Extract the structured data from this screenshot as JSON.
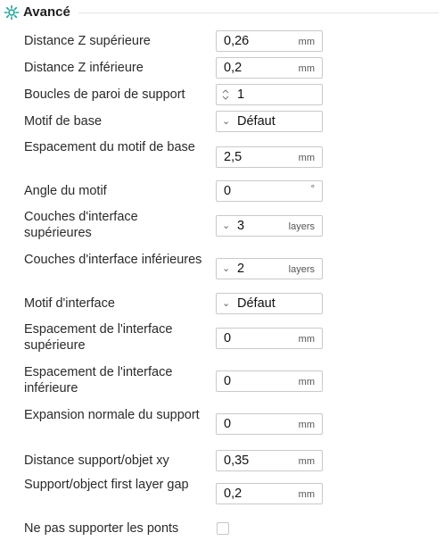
{
  "section": {
    "title": "Avancé",
    "icon": "settings-cog-icon"
  },
  "rows": [
    {
      "label": "Distance Z supérieure",
      "value": "0,26",
      "unit": "mm"
    },
    {
      "label": "Distance Z inférieure",
      "value": "0,2",
      "unit": "mm"
    },
    {
      "label": "Boucles de paroi de support",
      "value": "1"
    },
    {
      "label": "Motif de base",
      "value": "Défaut"
    },
    {
      "label": "Espacement du motif de base",
      "value": "2,5",
      "unit": "mm"
    },
    {
      "label": "Angle du motif",
      "value": "0",
      "unit": "°"
    },
    {
      "label": "Couches d'interface supérieures",
      "value": "3",
      "unit": "layers"
    },
    {
      "label": "Couches d'interface inférieures",
      "value": "2",
      "unit": "layers"
    },
    {
      "label": "Motif d'interface",
      "value": "Défaut"
    },
    {
      "label": "Espacement de l'interface supérieure",
      "value": "0",
      "unit": "mm"
    },
    {
      "label": "Espacement de l'interface inférieure",
      "value": "0",
      "unit": "mm"
    },
    {
      "label": "Expansion normale du support",
      "value": "0",
      "unit": "mm"
    },
    {
      "label": "Distance support/objet xy",
      "value": "0,35",
      "unit": "mm"
    },
    {
      "label": "Support/object first layer gap",
      "value": "0,2",
      "unit": "mm"
    },
    {
      "label": "Ne pas supporter les ponts",
      "checked": false
    }
  ]
}
